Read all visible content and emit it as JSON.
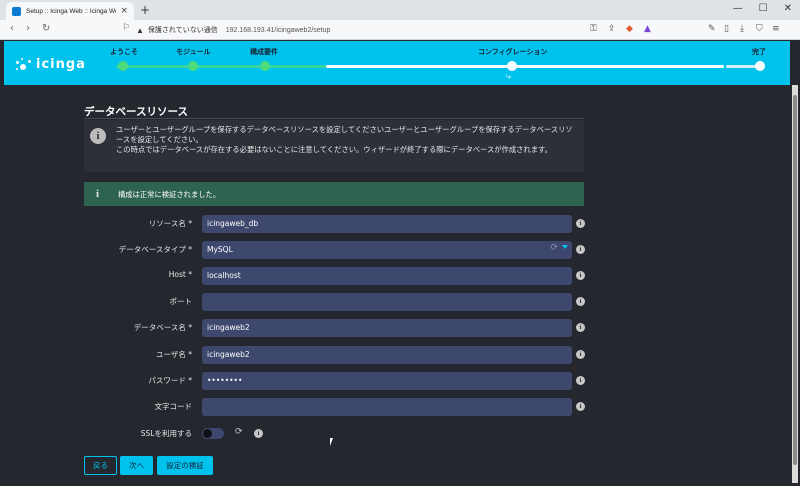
{
  "browser": {
    "tab_title": "Setup :: Icinga Web :: Icinga We",
    "new_tab": "+",
    "security_label": "保護されていない通信",
    "url": "192.168.193.41/icingaweb2/setup"
  },
  "wizard": {
    "logo_text": "icinga",
    "steps": [
      {
        "label": "ようこそ"
      },
      {
        "label": "モジュール"
      },
      {
        "label": "構成要件"
      },
      {
        "label": "コンフィグレーション"
      },
      {
        "label": "完了"
      }
    ]
  },
  "page": {
    "title": "データベースリソース",
    "info_text": "ユーザーとユーザーグループを保存するデータベースリソースを設定してくださいユーザーとユーザーグループを保存するデータベースリソースを設定してください。\nこの時点ではデータベースが存在する必要はないことに注意してください。ウィザードが終了する際にデータベースが作成されます。",
    "success_text": "構成は正常に検証されました。"
  },
  "form": {
    "resource_name": {
      "label": "リソース名 *",
      "value": "icingaweb_db"
    },
    "db_type": {
      "label": "データベースタイプ *",
      "value": "MySQL"
    },
    "host": {
      "label": "Host *",
      "value": "localhost"
    },
    "port": {
      "label": "ポート",
      "value": ""
    },
    "db_name": {
      "label": "データベース名 *",
      "value": "icingaweb2"
    },
    "username": {
      "label": "ユーザ名 *",
      "value": "icingaweb2"
    },
    "password": {
      "label": "パスワード *",
      "value": "••••••••"
    },
    "charset": {
      "label": "文字コード",
      "value": ""
    },
    "ssl": {
      "label": "SSLを利用する"
    }
  },
  "buttons": {
    "back": "戻る",
    "next": "次へ",
    "validate": "設定の検証"
  },
  "colors": {
    "accent": "#00c3ed",
    "background": "#25272e",
    "field": "#3e476d",
    "success": "#2e6352"
  }
}
